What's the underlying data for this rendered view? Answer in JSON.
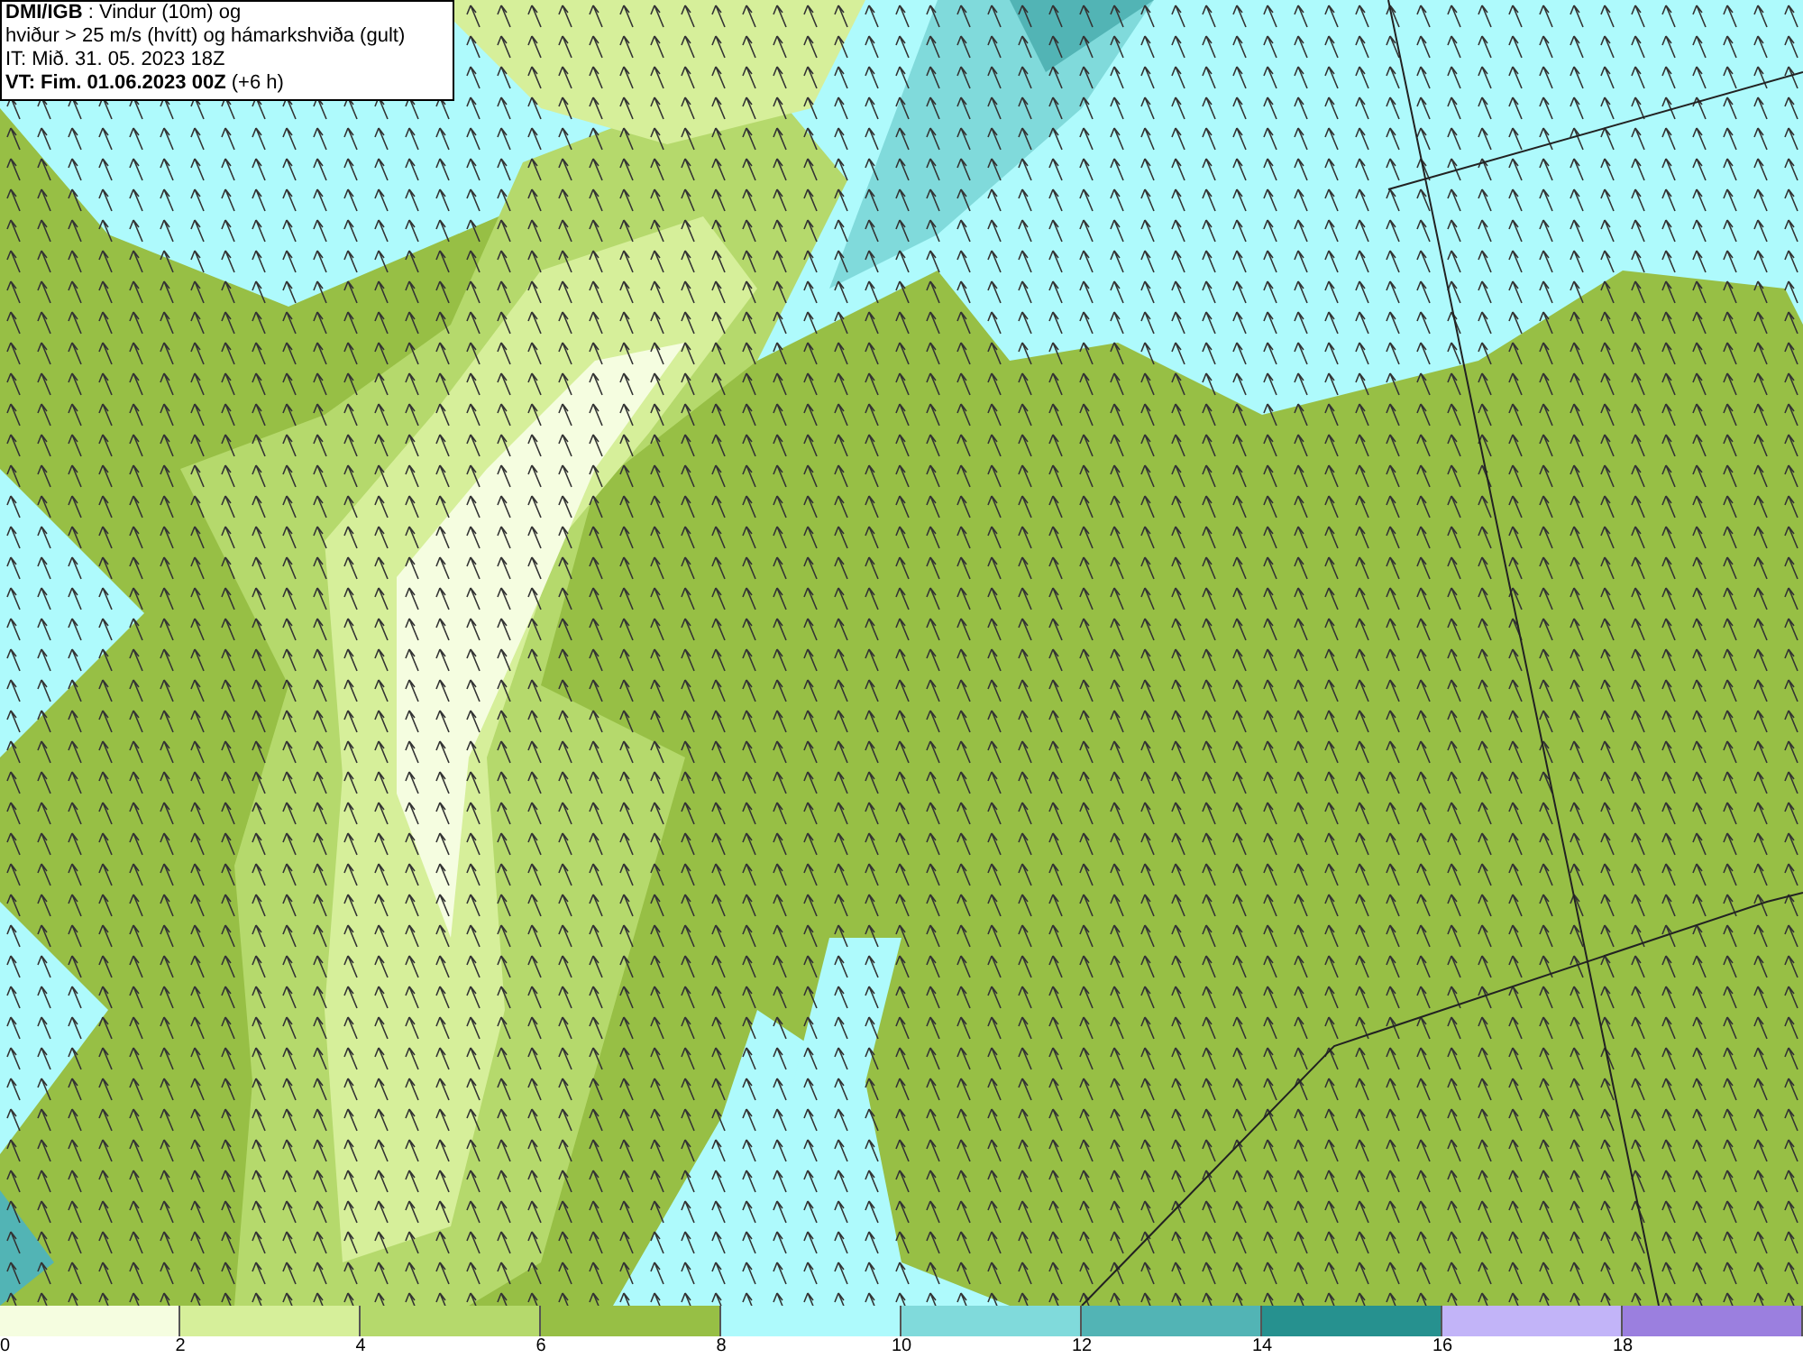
{
  "legend": {
    "lines": [
      "**DMI/IGB** : Vindur (10m) og",
      "hviður > 25 m/s (hvítt) og hámarkshviða (gult)",
      "IT: Mið. 31. 05. 2023 18Z",
      "**VT: Fim. 01.06.2023 00Z** (+6 h)"
    ]
  },
  "colorbar": [
    {
      "label": "0",
      "color": "#f5fde0"
    },
    {
      "label": "2",
      "color": "#d6ef9a"
    },
    {
      "label": "4",
      "color": "#b5d96c"
    },
    {
      "label": "6",
      "color": "#97bf45"
    },
    {
      "label": "8",
      "color": "#aefafc"
    },
    {
      "label": "10",
      "color": "#80dadb"
    },
    {
      "label": "12",
      "color": "#52b4b5"
    },
    {
      "label": "14",
      "color": "#26918f"
    },
    {
      "label": "16",
      "color": "#c2b4f8"
    },
    {
      "label": "18",
      "color": "#9b7fdf"
    }
  ]
}
